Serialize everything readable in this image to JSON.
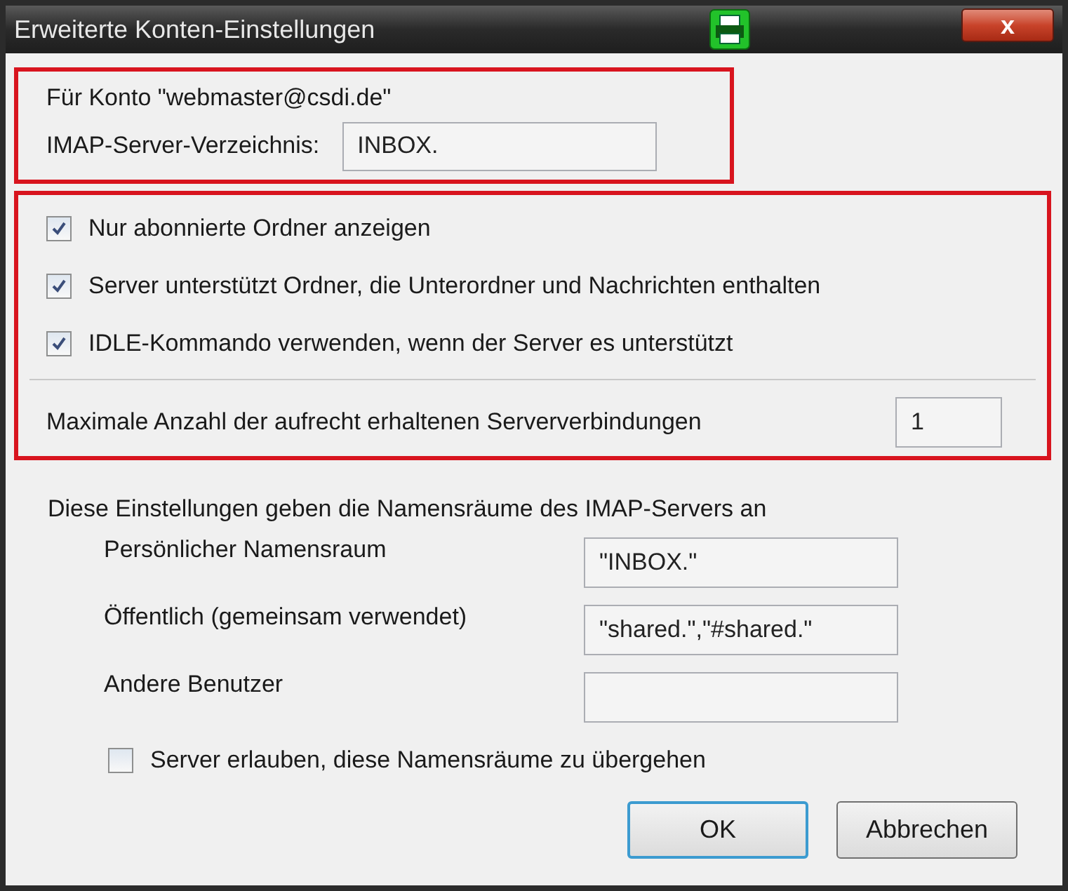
{
  "window": {
    "title": "Erweiterte Konten-Einstellungen",
    "close_label": "x"
  },
  "account": {
    "label": "Für Konto \"webmaster@csdi.de\"",
    "directory_label": "IMAP-Server-Verzeichnis:",
    "directory_value": "INBOX."
  },
  "options": [
    {
      "label": "Nur abonnierte Ordner anzeigen",
      "checked": true
    },
    {
      "label": "Server unterstützt Ordner, die Unterordner und Nachrichten enthalten",
      "checked": true
    },
    {
      "label": "IDLE-Kommando verwenden, wenn der Server es unterstützt",
      "checked": true
    }
  ],
  "connections": {
    "label": "Maximale Anzahl der aufrecht erhaltenen Serververbindungen",
    "value": "1"
  },
  "namespaces": {
    "intro": "Diese Einstellungen geben die Namensräume des IMAP-Servers an",
    "fields": [
      {
        "label": "Persönlicher Namensraum",
        "value": "\"INBOX.\""
      },
      {
        "label": "Öffentlich (gemeinsam verwendet)",
        "value": "\"shared.\",\"#shared.\""
      },
      {
        "label": "Andere Benutzer"
      }
    ],
    "override": {
      "label": "Server erlauben, diese Namensräume zu übergehen",
      "checked": false
    }
  },
  "buttons": [
    {
      "label": "OK",
      "default": true
    },
    {
      "label": "Abbrechen",
      "default": false
    }
  ]
}
